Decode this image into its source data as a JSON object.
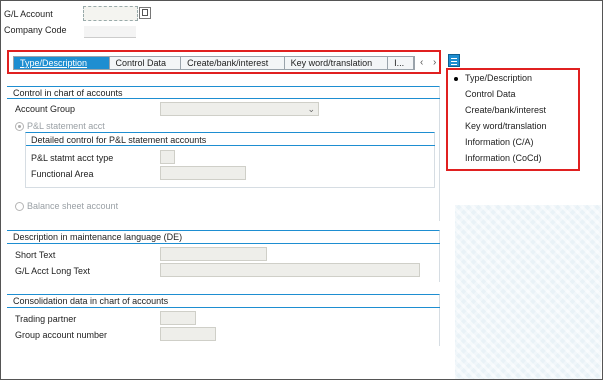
{
  "header": {
    "gl_account_label": "G/L Account",
    "company_code_label": "Company Code"
  },
  "tabs": [
    {
      "label": "Type/Description",
      "active": true
    },
    {
      "label": "Control Data",
      "active": false
    },
    {
      "label": "Create/bank/interest",
      "active": false
    },
    {
      "label": "Key word/translation",
      "active": false
    },
    {
      "label": "I...",
      "active": false
    }
  ],
  "tab_nav": {
    "prev": "‹",
    "next": "›"
  },
  "control": {
    "title": "Control in chart of accounts",
    "account_group_label": "Account Group",
    "pl_statement_label": "P&L statement acct",
    "detailed_title": "Detailed control for P&L statement accounts",
    "pl_type_label": "P&L statmt acct type",
    "functional_area_label": "Functional Area",
    "balance_sheet_label": "Balance sheet account"
  },
  "description": {
    "title": "Description in maintenance language (DE)",
    "short_text_label": "Short Text",
    "long_text_label": "G/L Acct Long Text"
  },
  "consolidation": {
    "title": "Consolidation data in chart of accounts",
    "trading_partner_label": "Trading partner",
    "group_account_label": "Group account number"
  },
  "menu": {
    "items": [
      {
        "label": "Type/Description",
        "selected": true
      },
      {
        "label": "Control Data",
        "selected": false
      },
      {
        "label": "Create/bank/interest",
        "selected": false
      },
      {
        "label": "Key word/translation",
        "selected": false
      },
      {
        "label": "Information (C/A)",
        "selected": false
      },
      {
        "label": "Information (CoCd)",
        "selected": false
      }
    ]
  },
  "colors": {
    "accent": "#1e8ed1",
    "highlight": "#e02020"
  }
}
